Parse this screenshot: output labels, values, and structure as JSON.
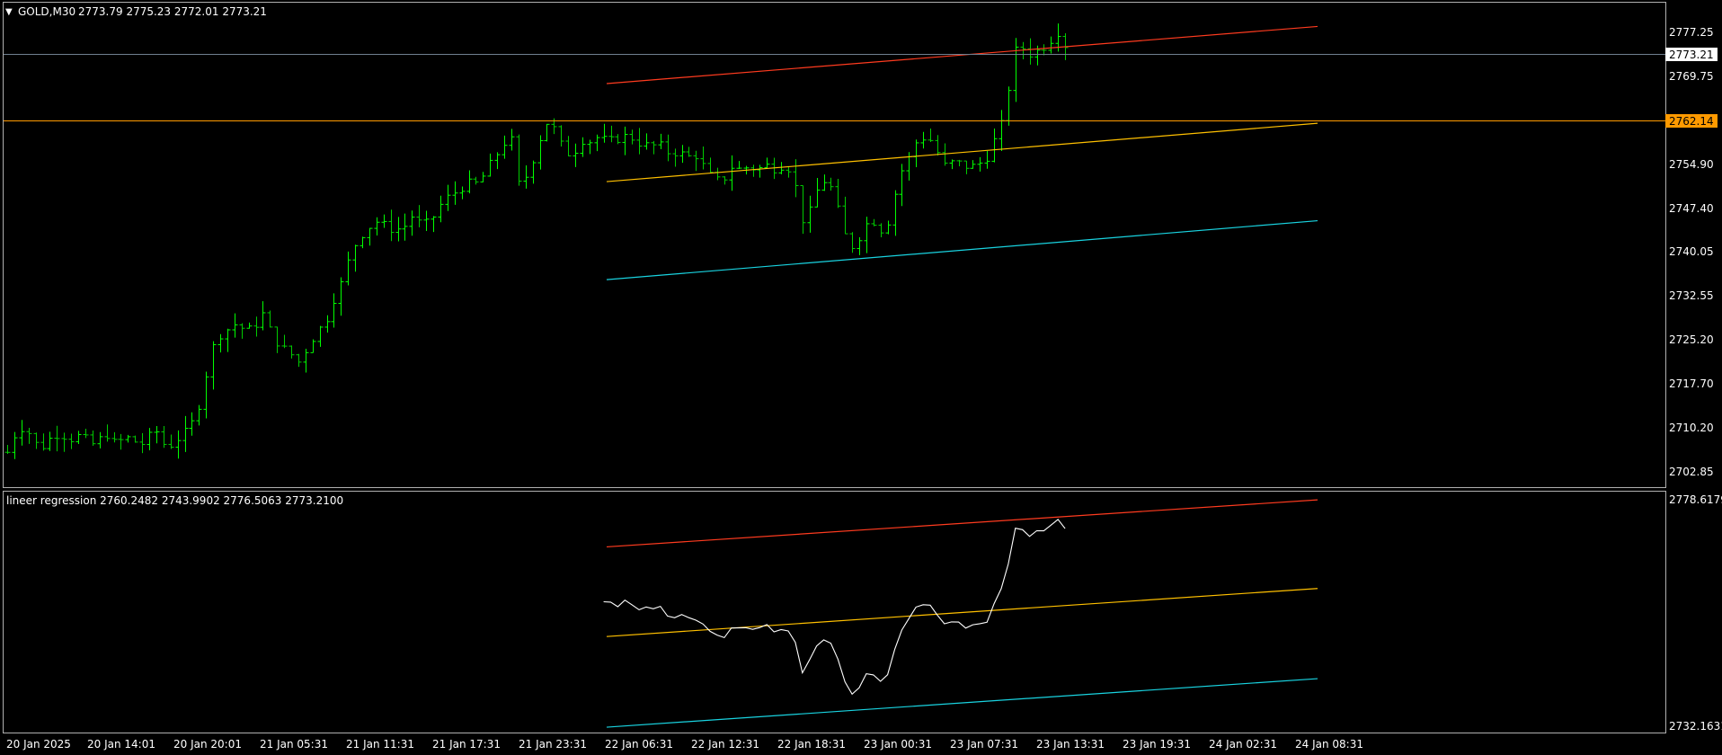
{
  "header": {
    "symbol_label": "GOLD,M30",
    "ohlc_text": "2773.79 2775.23 2772.01 2773.21",
    "menu_icon": "triangle-down-icon"
  },
  "main_price_axis": {
    "ticks": [
      "2777.25",
      "2769.75",
      "2754.90",
      "2747.40",
      "2740.05",
      "2732.55",
      "2725.20",
      "2717.70",
      "2710.20",
      "2702.85"
    ],
    "current_price_label": "2773.21",
    "level_label": "2762.14"
  },
  "indicator": {
    "title": "lineer regression 2760.2482 2743.9902 2776.5063 2773.2100",
    "axis_top_label": "2778.6179",
    "axis_bottom_label": "2732.1631"
  },
  "time_axis": {
    "labels": [
      "20 Jan 2025",
      "20 Jan 14:01",
      "20 Jan 20:01",
      "21 Jan 05:31",
      "21 Jan 11:31",
      "21 Jan 17:31",
      "21 Jan 23:31",
      "22 Jan 06:31",
      "22 Jan 12:31",
      "22 Jan 18:31",
      "23 Jan 00:31",
      "23 Jan 07:31",
      "23 Jan 13:31",
      "23 Jan 19:31",
      "24 Jan 02:31",
      "24 Jan 08:31"
    ]
  },
  "colors": {
    "background": "#000000",
    "candle_up": "#00ff00",
    "candle_down": "#00cc00",
    "grid_line": "#7a7a7a",
    "bid_line": "#708090",
    "level_line": "#ff9a00",
    "upper_channel": "#ff3b1f",
    "mid_channel": "#ffc000",
    "lower_channel": "#19d3e0",
    "indicator_line": "#ffffff"
  },
  "chart_data": [
    {
      "type": "candlestick",
      "title": "GOLD,M30",
      "ylim": [
        2700.0,
        2779.5
      ],
      "current_price": 2773.21,
      "horizontal_level": 2762.14,
      "close_path": {
        "x": [
          0,
          10,
          20,
          30,
          40,
          50,
          60,
          70,
          80,
          90,
          100,
          110,
          120,
          130,
          140,
          150,
          160,
          170,
          180,
          190,
          200,
          210,
          220,
          230,
          240,
          250,
          260,
          270,
          280,
          290,
          300,
          310,
          320,
          330,
          340,
          350,
          360,
          370,
          380,
          390,
          400,
          410,
          420,
          430,
          440,
          450,
          460,
          470,
          480,
          490,
          500,
          510,
          520,
          530,
          540,
          550,
          560,
          570,
          580,
          590,
          600,
          610,
          620,
          630,
          640,
          650,
          660,
          670,
          680,
          690,
          700,
          710,
          720,
          730,
          740,
          750,
          760,
          770,
          780,
          790,
          800,
          810,
          820,
          830,
          840,
          850,
          860,
          870,
          880,
          890,
          900,
          910,
          920,
          930,
          940,
          950,
          960,
          970,
          980,
          990,
          1000,
          1010,
          1020,
          1030,
          1040,
          1050,
          1060,
          1070,
          1080,
          1090,
          1100,
          1110,
          1120,
          1130,
          1140,
          1150,
          1160,
          1170,
          1180,
          1190,
          1199
        ],
        "y": [
          2705.5,
          2709,
          2710,
          2707,
          2706.5,
          2708,
          2708.8,
          2707.6,
          2708.2,
          2707.5,
          2706.5,
          2709,
          2707,
          2707.5,
          2708,
          2706.5,
          2708,
          2709,
          2706,
          2707.5,
          2708.5,
          2710.5,
          2714.5,
          2722,
          2725,
          2726,
          2727,
          2725.5,
          2726.5,
          2728.5,
          2725,
          2723,
          2722,
          2720.5,
          2723,
          2725.5,
          2727,
          2731,
          2734,
          2739,
          2741.5,
          2743,
          2744,
          2742.8,
          2742.5,
          2743,
          2745,
          2743,
          2744,
          2746.5,
          2748,
          2749,
          2750.2,
          2750,
          2751.5,
          2754,
          2756.2,
          2758.5,
          2749.5,
          2752,
          2756.2,
          2760.5,
          2759.2,
          2755.8,
          2754.8,
          2757.5,
          2757.2,
          2758,
          2757,
          2757.6,
          2758,
          2757.7,
          2756.5,
          2756.5,
          2756.4,
          2755.2,
          2755.5,
          2754.5,
          2755,
          2752.8,
          2750.8,
          2750.5,
          2753,
          2752.5,
          2753,
          2752.5,
          2753.2,
          2752.7,
          2753.4,
          2752.2,
          2744,
          2745.6,
          2750.2,
          2751,
          2746.5,
          2741.3,
          2739.3,
          2743,
          2744.2,
          2742.5,
          2744.3,
          2751.5,
          2753.7,
          2757,
          2758,
          2757,
          2753,
          2753.6,
          2753.5,
          2752.8,
          2753.3,
          2754.5,
          2757.8,
          2761,
          2772,
          2772.8,
          2771.6,
          2772.5,
          2773.5,
          2775.7,
          2773.2
        ]
      }
    },
    {
      "type": "line",
      "title": "lineer regression 2760.2482 2743.9902 2776.5063 2773.2100",
      "ylim": [
        2732.1631,
        2778.6179
      ]
    }
  ]
}
